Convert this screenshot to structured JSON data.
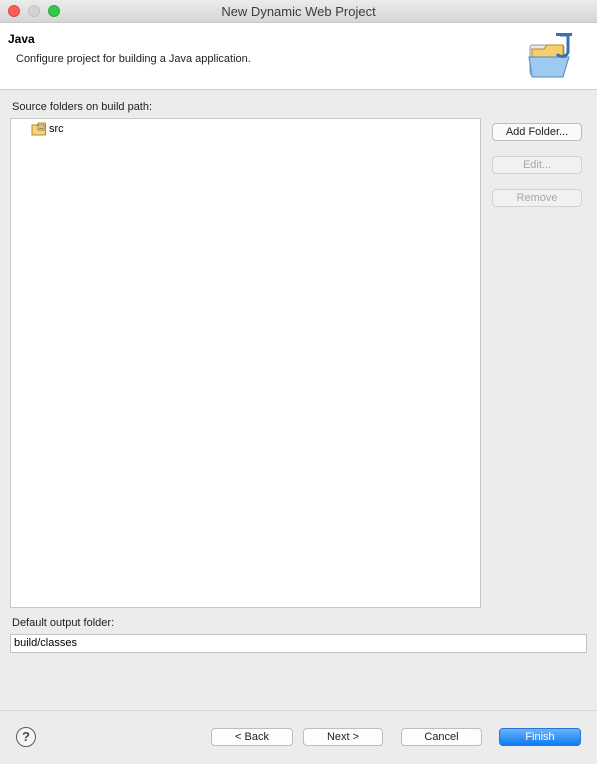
{
  "window": {
    "title": "New Dynamic Web Project"
  },
  "banner": {
    "title": "Java",
    "description": "Configure project for building a Java application.",
    "icon": "java-folder-icon"
  },
  "source": {
    "label": "Source folders on build path:",
    "items": [
      {
        "label": "src",
        "icon": "source-folder-icon"
      }
    ],
    "buttons": {
      "add_folder": "Add Folder...",
      "edit": "Edit...",
      "remove": "Remove"
    }
  },
  "output": {
    "label": "Default output folder:",
    "value": "build/classes"
  },
  "footer": {
    "help": "?",
    "back": "< Back",
    "next": "Next >",
    "cancel": "Cancel",
    "finish": "Finish"
  },
  "colors": {
    "accent": "#0d7bf2"
  }
}
